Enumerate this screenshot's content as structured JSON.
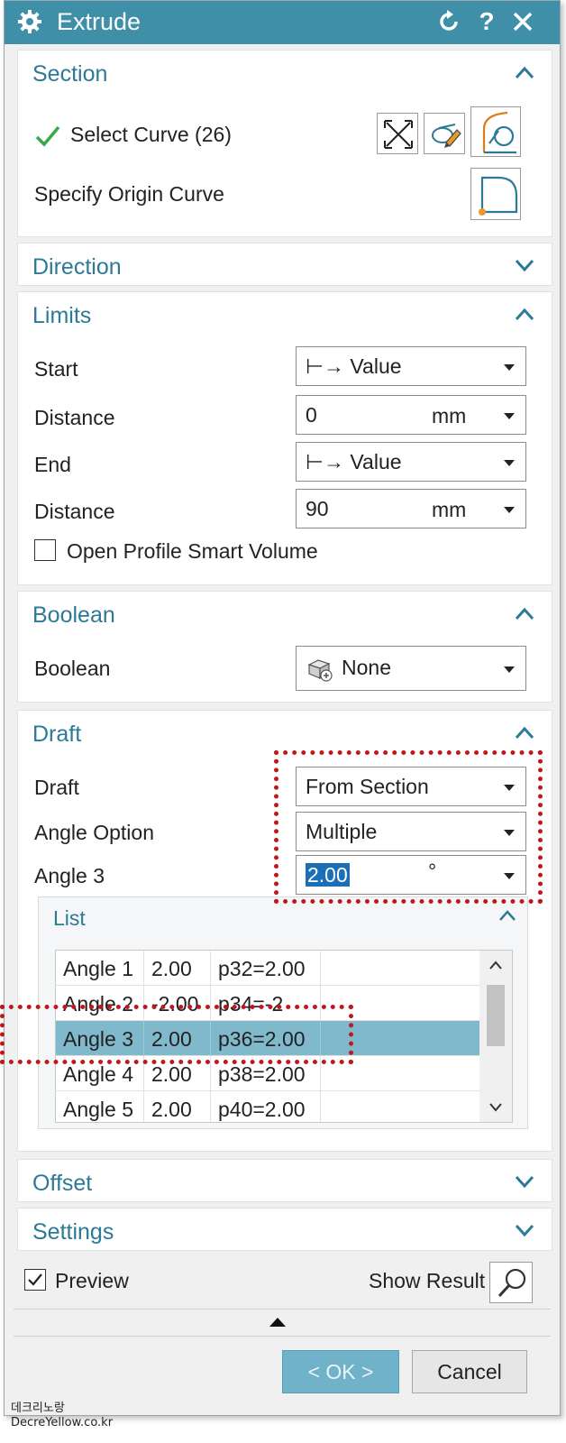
{
  "window": {
    "title": "Extrude"
  },
  "section": {
    "title": "Section",
    "select_curve_label": "Select Curve (26)",
    "specify_origin_label": "Specify Origin Curve"
  },
  "direction": {
    "title": "Direction"
  },
  "limits": {
    "title": "Limits",
    "start_label": "Start",
    "start_value": "⊢→ Value",
    "distance1_label": "Distance",
    "distance1_value": "0",
    "distance1_unit": "mm",
    "end_label": "End",
    "end_value": "⊢→ Value",
    "distance2_label": "Distance",
    "distance2_value": "90",
    "distance2_unit": "mm",
    "open_profile_label": "Open Profile Smart Volume"
  },
  "boolean": {
    "title": "Boolean",
    "label": "Boolean",
    "value": "None"
  },
  "draft": {
    "title": "Draft",
    "draft_label": "Draft",
    "draft_value": "From Section",
    "angle_option_label": "Angle Option",
    "angle_option_value": "Multiple",
    "angle3_label": "Angle 3",
    "angle3_value": "2.00",
    "angle3_unit": "°"
  },
  "list": {
    "title": "List",
    "rows": [
      {
        "name": "Angle 1",
        "value": "2.00",
        "expr": "p32=2.00"
      },
      {
        "name": "Angle 2",
        "value": "-2.00",
        "expr": "p34=-2"
      },
      {
        "name": "Angle 3",
        "value": "2.00",
        "expr": "p36=2.00"
      },
      {
        "name": "Angle 4",
        "value": "2.00",
        "expr": "p38=2.00"
      },
      {
        "name": "Angle 5",
        "value": "2.00",
        "expr": "p40=2.00"
      }
    ]
  },
  "offset": {
    "title": "Offset"
  },
  "settings": {
    "title": "Settings"
  },
  "footer": {
    "preview_label": "Preview",
    "show_result_label": "Show Result",
    "ok_label": "< OK >",
    "cancel_label": "Cancel"
  },
  "watermark": {
    "line1": "데크리노랑",
    "line2": "DecreYellow.co.kr"
  },
  "colors": {
    "accent": "#3f8fa9",
    "header_text": "#2c7a96",
    "selection": "#7fb9cb",
    "highlight_box": "#c0171b"
  }
}
